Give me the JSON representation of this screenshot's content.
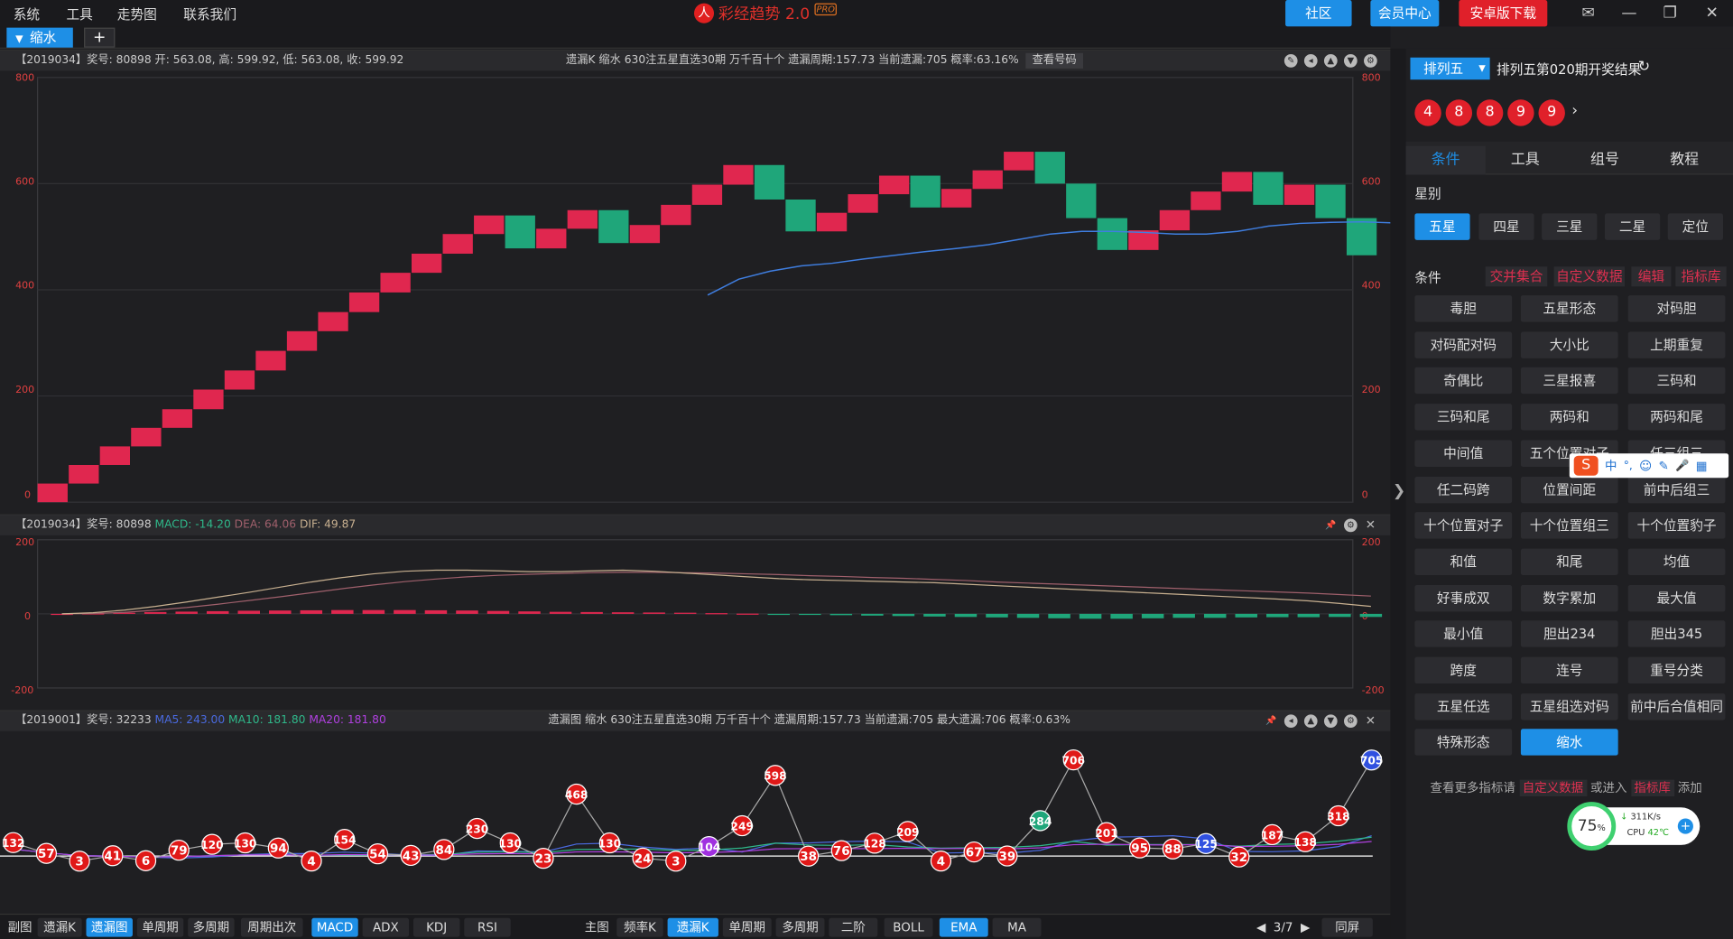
{
  "menu": [
    "系统",
    "工具",
    "走势图",
    "联系我们"
  ],
  "logo": {
    "text": "彩经趋势 2.0",
    "pro": "PRO",
    "mark": "人"
  },
  "top_buttons": {
    "community": "社区",
    "member": "会员中心",
    "android": "安卓版下载"
  },
  "window_icons": {
    "mail": "✉",
    "minimize": "—",
    "restore": "❐",
    "close": "✕"
  },
  "tabs": {
    "active": "缩水",
    "add": "+"
  },
  "panel1": {
    "info": "【2019034】奖号: 80898  开: 563.08, 高: 599.92, 低: 563.08, 收: 599.92",
    "mid": "遗漏K  缩水  630注五星直选30期  万千百十个  遗漏周期:157.73  当前遗漏:705  概率:63.16%",
    "btn": "查看号码",
    "yticks": [
      "800",
      "600",
      "400",
      "200",
      "0"
    ]
  },
  "panel2": {
    "info_prefix": "【2019034】奖号: 80898",
    "macd": "MACD: -14.20",
    "dea": "DEA: 64.06",
    "dif": "DIF: 49.87",
    "yticks": [
      "200",
      "0",
      "-200"
    ]
  },
  "panel3": {
    "info_prefix": "【2019001】奖号: 32233",
    "ma5": "MA5: 243.00",
    "ma10": "MA10: 181.80",
    "ma20": "MA20: 181.80",
    "mid": "遗漏图  缩水  630注五星直选30期  万千百十个  遗漏周期:157.73  当前遗漏:705  最大遗漏:706  概率:0.63%"
  },
  "bottom_left": [
    "副图",
    "遗漏K",
    "遗漏图",
    "单周期",
    "多周期",
    "周期出次",
    "MACD",
    "ADX",
    "KDJ",
    "RSI"
  ],
  "bottom_mid": [
    "主图",
    "频率K",
    "遗漏K",
    "单周期",
    "多周期",
    "二阶",
    "BOLL",
    "EMA",
    "MA"
  ],
  "pager": {
    "prev": "◀",
    "text": "3/7",
    "next": "▶",
    "screen": "同屏"
  },
  "sidebar": {
    "lottery": "排列五",
    "title": "排列五第020期开奖结果",
    "balls": [
      "4",
      "8",
      "8",
      "9",
      "9"
    ],
    "tabs": [
      "条件",
      "工具",
      "组号",
      "教程"
    ],
    "star_label": "星别",
    "stars": [
      "五星",
      "四星",
      "三星",
      "二星",
      "定位"
    ],
    "cond_label": "条件",
    "cond_links": [
      "交并集合",
      "自定义数据",
      "编辑",
      "指标库"
    ],
    "conditions": [
      "毒胆",
      "五星形态",
      "对码胆",
      "对码配对码",
      "大小比",
      "上期重复",
      "奇偶比",
      "三星报喜",
      "三码和",
      "三码和尾",
      "两码和",
      "两码和尾",
      "中间值",
      "五个位置对子",
      "任三组三",
      "任二码跨",
      "位置间距",
      "前中后组三",
      "十个位置对子",
      "十个位置组三",
      "十个位置豹子",
      "和值",
      "和尾",
      "均值",
      "好事成双",
      "数字累加",
      "最大值",
      "最小值",
      "胆出234",
      "胆出345",
      "跨度",
      "连号",
      "重号分类",
      "五星任选",
      "五星组选对码",
      "前中后合值相同",
      "特殊形态",
      "缩水"
    ],
    "footer": {
      "a": "查看更多指标请",
      "b": "自定义数据",
      "c": "或进入",
      "d": "指标库",
      "e": "添加"
    },
    "ime": [
      "中",
      "°,",
      "☺",
      "✎",
      "🎤",
      "▦"
    ],
    "monitor": {
      "pct": "75",
      "unit": "%",
      "speed": "311K/s",
      "cpu": "CPU",
      "temp": "42℃"
    }
  },
  "chart_data": [
    {
      "type": "candlestick",
      "ylim": [
        0,
        800
      ],
      "yticks": [
        0,
        200,
        400,
        600,
        800
      ],
      "candles": [
        {
          "o": 0,
          "c": 35,
          "up": true
        },
        {
          "o": 35,
          "c": 70,
          "up": true
        },
        {
          "o": 70,
          "c": 105,
          "up": true
        },
        {
          "o": 105,
          "c": 140,
          "up": true
        },
        {
          "o": 140,
          "c": 175,
          "up": true
        },
        {
          "o": 175,
          "c": 212,
          "up": true
        },
        {
          "o": 212,
          "c": 248,
          "up": true
        },
        {
          "o": 248,
          "c": 285,
          "up": true
        },
        {
          "o": 285,
          "c": 322,
          "up": true
        },
        {
          "o": 322,
          "c": 358,
          "up": true
        },
        {
          "o": 358,
          "c": 395,
          "up": true
        },
        {
          "o": 395,
          "c": 432,
          "up": true
        },
        {
          "o": 432,
          "c": 468,
          "up": true
        },
        {
          "o": 468,
          "c": 505,
          "up": true
        },
        {
          "o": 505,
          "c": 540,
          "up": true
        },
        {
          "o": 540,
          "c": 478,
          "up": false
        },
        {
          "o": 478,
          "c": 515,
          "up": true
        },
        {
          "o": 515,
          "c": 550,
          "up": true
        },
        {
          "o": 550,
          "c": 488,
          "up": false
        },
        {
          "o": 488,
          "c": 522,
          "up": true
        },
        {
          "o": 522,
          "c": 560,
          "up": true
        },
        {
          "o": 560,
          "c": 598,
          "up": true
        },
        {
          "o": 598,
          "c": 635,
          "up": true
        },
        {
          "o": 635,
          "c": 570,
          "up": false
        },
        {
          "o": 570,
          "c": 510,
          "up": false
        },
        {
          "o": 510,
          "c": 545,
          "up": true
        },
        {
          "o": 545,
          "c": 580,
          "up": true
        },
        {
          "o": 580,
          "c": 615,
          "up": true
        },
        {
          "o": 615,
          "c": 555,
          "up": false
        },
        {
          "o": 555,
          "c": 590,
          "up": true
        },
        {
          "o": 590,
          "c": 625,
          "up": true
        },
        {
          "o": 625,
          "c": 660,
          "up": true
        },
        {
          "o": 660,
          "c": 600,
          "up": false
        },
        {
          "o": 600,
          "c": 535,
          "up": false
        },
        {
          "o": 535,
          "c": 475,
          "up": false
        },
        {
          "o": 475,
          "c": 512,
          "up": true
        },
        {
          "o": 512,
          "c": 550,
          "up": true
        },
        {
          "o": 550,
          "c": 585,
          "up": true
        },
        {
          "o": 585,
          "c": 622,
          "up": true
        },
        {
          "o": 622,
          "c": 560,
          "up": false
        },
        {
          "o": 560,
          "c": 598,
          "up": true
        },
        {
          "o": 598,
          "c": 535,
          "up": false
        },
        {
          "o": 535,
          "c": 465,
          "up": false
        }
      ],
      "ma_line": [
        [
          21,
          390
        ],
        [
          22,
          420
        ],
        [
          23,
          435
        ],
        [
          24,
          445
        ],
        [
          25,
          450
        ],
        [
          26,
          458
        ],
        [
          27,
          465
        ],
        [
          28,
          472
        ],
        [
          29,
          478
        ],
        [
          30,
          485
        ],
        [
          31,
          495
        ],
        [
          32,
          505
        ],
        [
          33,
          510
        ],
        [
          34,
          510
        ],
        [
          35,
          508
        ],
        [
          36,
          505
        ],
        [
          37,
          505
        ],
        [
          38,
          510
        ],
        [
          39,
          520
        ],
        [
          40,
          525
        ],
        [
          41,
          527
        ],
        [
          42,
          528
        ],
        [
          43,
          526
        ],
        [
          44,
          520
        ]
      ]
    },
    {
      "type": "bar+line",
      "ylim": [
        -200,
        200
      ],
      "yticks": [
        200,
        0,
        -200
      ],
      "bars": [
        0,
        2,
        5,
        8,
        10,
        12,
        14,
        15,
        16,
        17,
        17,
        17,
        16,
        15,
        13,
        11,
        9,
        8,
        7,
        6,
        5,
        3,
        1,
        -2,
        -4,
        -6,
        -8,
        -10,
        -12,
        -14,
        -16,
        -18,
        -20,
        -22,
        -22,
        -20,
        -18,
        -18,
        -16,
        -15,
        -15,
        -14,
        -14
      ],
      "dif": [
        0,
        3,
        10,
        20,
        32,
        45,
        58,
        72,
        86,
        98,
        108,
        115,
        118,
        118,
        116,
        114,
        114,
        116,
        118,
        115,
        110,
        105,
        100,
        95,
        92,
        90,
        88,
        86,
        84,
        80,
        76,
        72,
        68,
        64,
        60,
        56,
        52,
        48,
        44,
        40,
        35,
        28,
        20
      ],
      "dea": [
        0,
        1,
        4,
        10,
        17,
        26,
        36,
        46,
        57,
        68,
        78,
        87,
        94,
        100,
        104,
        107,
        109,
        111,
        112,
        112,
        111,
        110,
        108,
        106,
        103,
        101,
        98,
        96,
        93,
        90,
        86,
        83,
        80,
        77,
        74,
        71,
        68,
        65,
        62,
        59,
        56,
        52,
        48
      ]
    },
    {
      "type": "scatter-line",
      "values": [
        132,
        57,
        3,
        41,
        6,
        79,
        120,
        130,
        94,
        4,
        154,
        54,
        43,
        84,
        230,
        130,
        23,
        468,
        130,
        24,
        3,
        104,
        249,
        598,
        38,
        76,
        128,
        209,
        4,
        67,
        39,
        284,
        706,
        201,
        95,
        88,
        125,
        32,
        187,
        138,
        318,
        705
      ],
      "special": {
        "21": "purple",
        "31": "green",
        "36": "blue",
        "41": "blue"
      }
    }
  ]
}
